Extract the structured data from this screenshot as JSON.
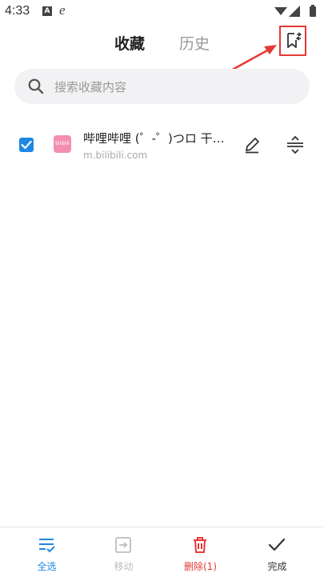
{
  "status_bar": {
    "time": "4:33",
    "notif_a": "A",
    "notif_e": "e"
  },
  "header": {
    "tab_favorites": "收藏",
    "tab_history": "历史",
    "sort_icon": "bookmark-sort-icon"
  },
  "search": {
    "placeholder": "搜索收藏内容"
  },
  "bookmarks": [
    {
      "title": "哔哩哔哩 (゜-゜)つロ 干杯~-bilibili",
      "url": "m.bilibili.com",
      "favicon_text": "bilibili",
      "checked": true
    }
  ],
  "bottom_bar": {
    "select_all": "全选",
    "move": "移动",
    "delete": "删除(1)",
    "done": "完成"
  },
  "colors": {
    "accent": "#1e88e5",
    "danger": "#e53935",
    "disabled": "#bdbdbd",
    "annotation": "#e53935"
  }
}
